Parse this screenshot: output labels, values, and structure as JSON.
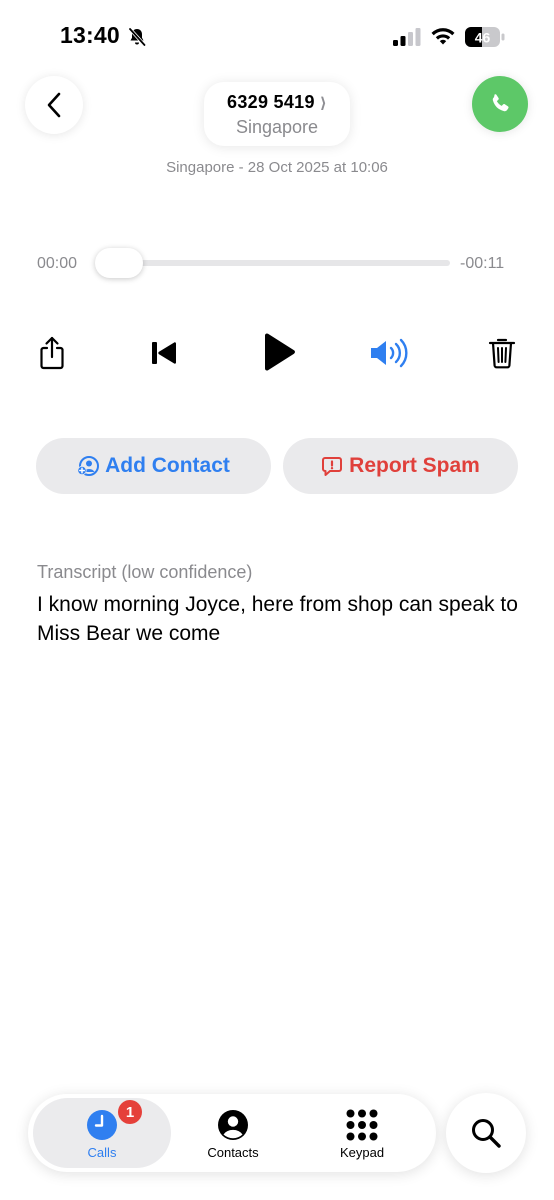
{
  "status_bar": {
    "time": "13:40",
    "battery_level": "46",
    "icons": [
      "bell-slash-icon",
      "cellular-signal-icon",
      "wifi-icon",
      "battery-icon"
    ]
  },
  "header": {
    "back_icon": "chevron-left-icon",
    "caller_number": "6329 5419",
    "caller_chevron": "⟩",
    "caller_location": "Singapore",
    "call_icon": "phone-icon",
    "call_meta": "Singapore - 28 Oct 2025 at 10:06"
  },
  "player": {
    "elapsed": "00:00",
    "remaining": "-00:11",
    "progress": 0,
    "controls": [
      "share-icon",
      "skip-back-icon",
      "play-icon",
      "speaker-icon",
      "trash-icon"
    ]
  },
  "actions": {
    "add_contact_label": "Add Contact",
    "report_spam_label": "Report Spam"
  },
  "transcript": {
    "label": "Transcript (low confidence)",
    "text": "I know morning Joyce, here from shop can speak to Miss Bear we come"
  },
  "tab_bar": {
    "tabs": [
      {
        "label": "Calls",
        "icon": "clock-icon",
        "badge": "1",
        "selected": true
      },
      {
        "label": "Contacts",
        "icon": "person-circle-icon",
        "selected": false
      },
      {
        "label": "Keypad",
        "icon": "keypad-icon",
        "selected": false
      }
    ],
    "search_icon": "search-icon"
  },
  "colors": {
    "accent_blue": "#2f7ff0",
    "call_green": "#5dc868",
    "spam_red": "#e0403b",
    "badge_red": "#e5403a"
  }
}
